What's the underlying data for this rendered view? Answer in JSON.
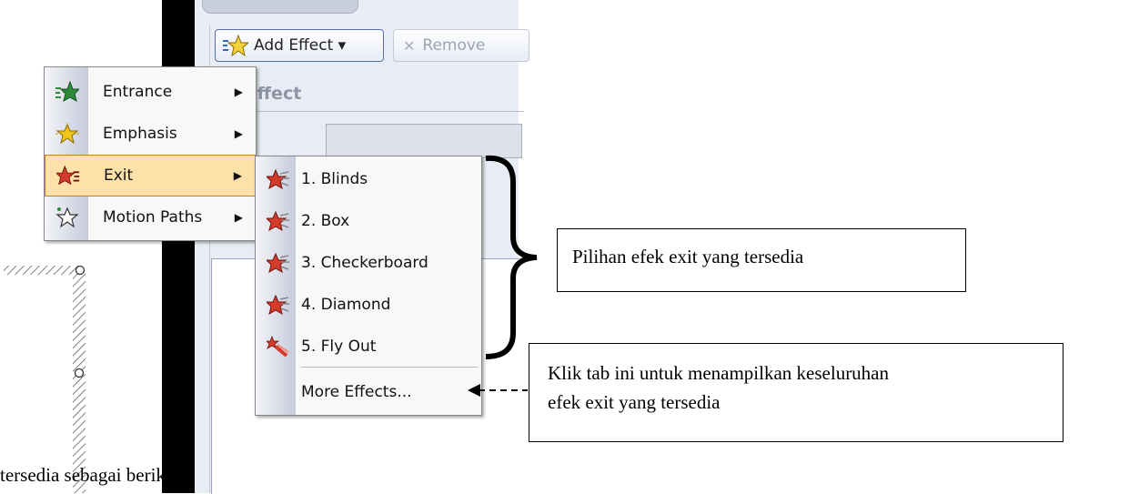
{
  "toolbar": {
    "add_effect_label": "Add Effect ▾",
    "remove_label": "Remove"
  },
  "pane": {
    "modify_label": "ify effect",
    "start_label": ":"
  },
  "menu_primary": {
    "items": [
      {
        "label": "Entrance",
        "icon": "entrance-star-icon"
      },
      {
        "label": "Emphasis",
        "icon": "emphasis-star-icon"
      },
      {
        "label": "Exit",
        "icon": "exit-star-icon"
      },
      {
        "label": "Motion Paths",
        "icon": "motion-path-star-icon"
      }
    ]
  },
  "menu_exit": {
    "items": [
      {
        "label": "1. Blinds"
      },
      {
        "label": "2. Box"
      },
      {
        "label": "3. Checkerboard"
      },
      {
        "label": "4. Diamond"
      },
      {
        "label": "5. Fly Out"
      }
    ],
    "more": "More Effects..."
  },
  "annotations": {
    "brace_note": "Pilihan efek exit yang tersedia",
    "more_note_line1": "Klik tab ini untuk menampilkan keseluruhan",
    "more_note_line2": "efek exit yang tersedia"
  },
  "document": {
    "bottom_text": "tersedia sebagai berikut :"
  },
  "colors": {
    "highlight": "#fde1a8",
    "highlight_border": "#cc7d1d",
    "exit_star": "#d63a2a",
    "entrance_star": "#2f8a3b",
    "emphasis_star": "#f0c419"
  }
}
